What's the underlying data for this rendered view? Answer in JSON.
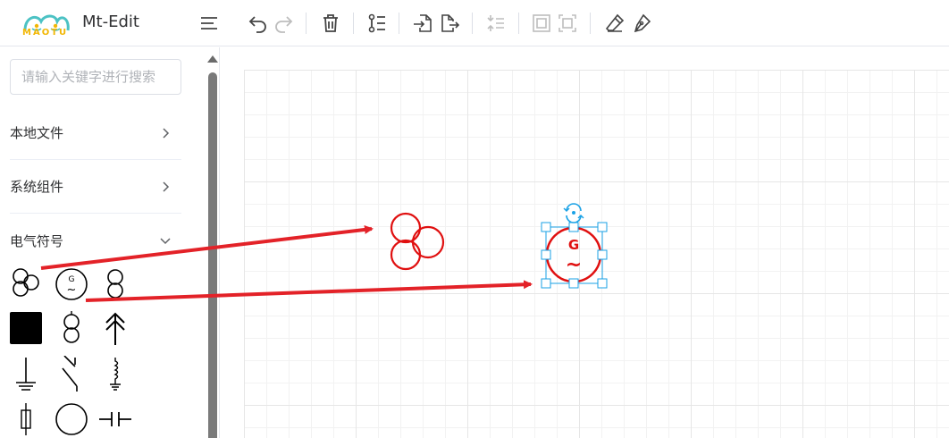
{
  "app": {
    "title": "Mt-Edit",
    "logo_text": "MAOTU"
  },
  "toolbar": {
    "menu_icon": "menu-icon",
    "undo_icon": "undo-icon",
    "redo_icon": "redo-icon",
    "delete_icon": "trash-icon",
    "layers_icon": "layers-list-icon",
    "import_icon": "file-import-icon",
    "export_icon": "file-export-icon",
    "align_icon": "align-icon",
    "group_icon": "group-icon",
    "ungroup_icon": "ungroup-icon",
    "edit_icon": "eraser-icon",
    "pen_icon": "pen-icon"
  },
  "sidebar": {
    "search_placeholder": "请输入关键字进行搜索",
    "categories": [
      {
        "label": "本地文件",
        "state": "collapsed"
      },
      {
        "label": "系统组件",
        "state": "collapsed"
      },
      {
        "label": "电气符号",
        "state": "expanded"
      }
    ],
    "symbols": [
      {
        "name": "three-winding-transformer",
        "generator_letter": ""
      },
      {
        "name": "generator",
        "generator_letter": "G",
        "generator_wave": "~"
      },
      {
        "name": "two-winding-transformer"
      },
      {
        "name": "black-block"
      },
      {
        "name": "transformer-variant"
      },
      {
        "name": "arrow-up"
      },
      {
        "name": "ground"
      },
      {
        "name": "switch"
      },
      {
        "name": "inductor-ground"
      },
      {
        "name": "fuse"
      },
      {
        "name": "circle"
      },
      {
        "name": "capacitor"
      }
    ]
  },
  "canvas": {
    "placed_generator": {
      "letter": "G",
      "wave": "~",
      "color": "#e01010",
      "selected": true
    },
    "selection_color": "#1aa2e6",
    "annotation_color": "#e32228"
  }
}
